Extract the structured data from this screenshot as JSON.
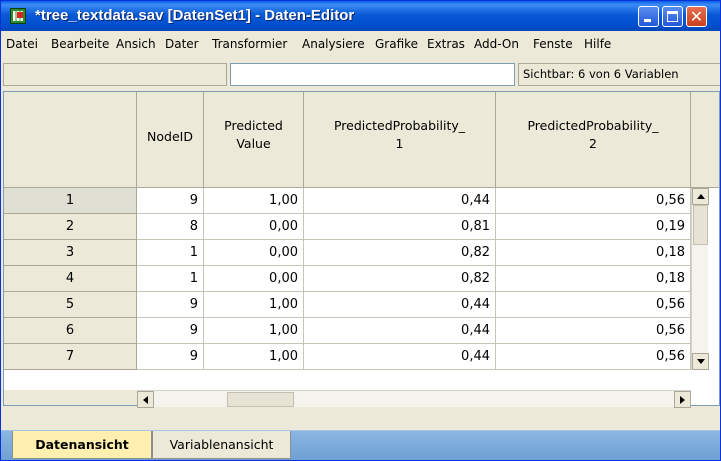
{
  "window": {
    "title": "*tree_textdata.sav [DatenSet1] - Daten-Editor",
    "minimize_label": "",
    "maximize_label": "",
    "close_label": "✕"
  },
  "menu": [
    "Datei",
    "Bearbeite",
    "Ansich",
    "Dater",
    "Transformier",
    "Analysiere",
    "Grafike",
    "Extras",
    "Add-On",
    "Fenste",
    "Hilfe"
  ],
  "info": {
    "cell_ref": "",
    "cell_value": "",
    "visible_vars": "Sichtbar: 6 von 6 Variablen"
  },
  "columns": [
    {
      "line1": "NodeID",
      "line2": ""
    },
    {
      "line1": "Predicted",
      "line2": "Value"
    },
    {
      "line1": "PredictedProbability_",
      "line2": "1"
    },
    {
      "line1": "PredictedProbability_",
      "line2": "2"
    }
  ],
  "rows": [
    {
      "num": "1",
      "cells": [
        "9",
        "1,00",
        "0,44",
        "0,56"
      ]
    },
    {
      "num": "2",
      "cells": [
        "8",
        "0,00",
        "0,81",
        "0,19"
      ]
    },
    {
      "num": "3",
      "cells": [
        "1",
        "0,00",
        "0,82",
        "0,18"
      ]
    },
    {
      "num": "4",
      "cells": [
        "1",
        "0,00",
        "0,82",
        "0,18"
      ]
    },
    {
      "num": "5",
      "cells": [
        "9",
        "1,00",
        "0,44",
        "0,56"
      ]
    },
    {
      "num": "6",
      "cells": [
        "9",
        "1,00",
        "0,44",
        "0,56"
      ]
    },
    {
      "num": "7",
      "cells": [
        "9",
        "1,00",
        "0,44",
        "0,56"
      ]
    }
  ],
  "tabs": {
    "data_view": "Datenansicht",
    "variable_view": "Variablenansicht"
  }
}
